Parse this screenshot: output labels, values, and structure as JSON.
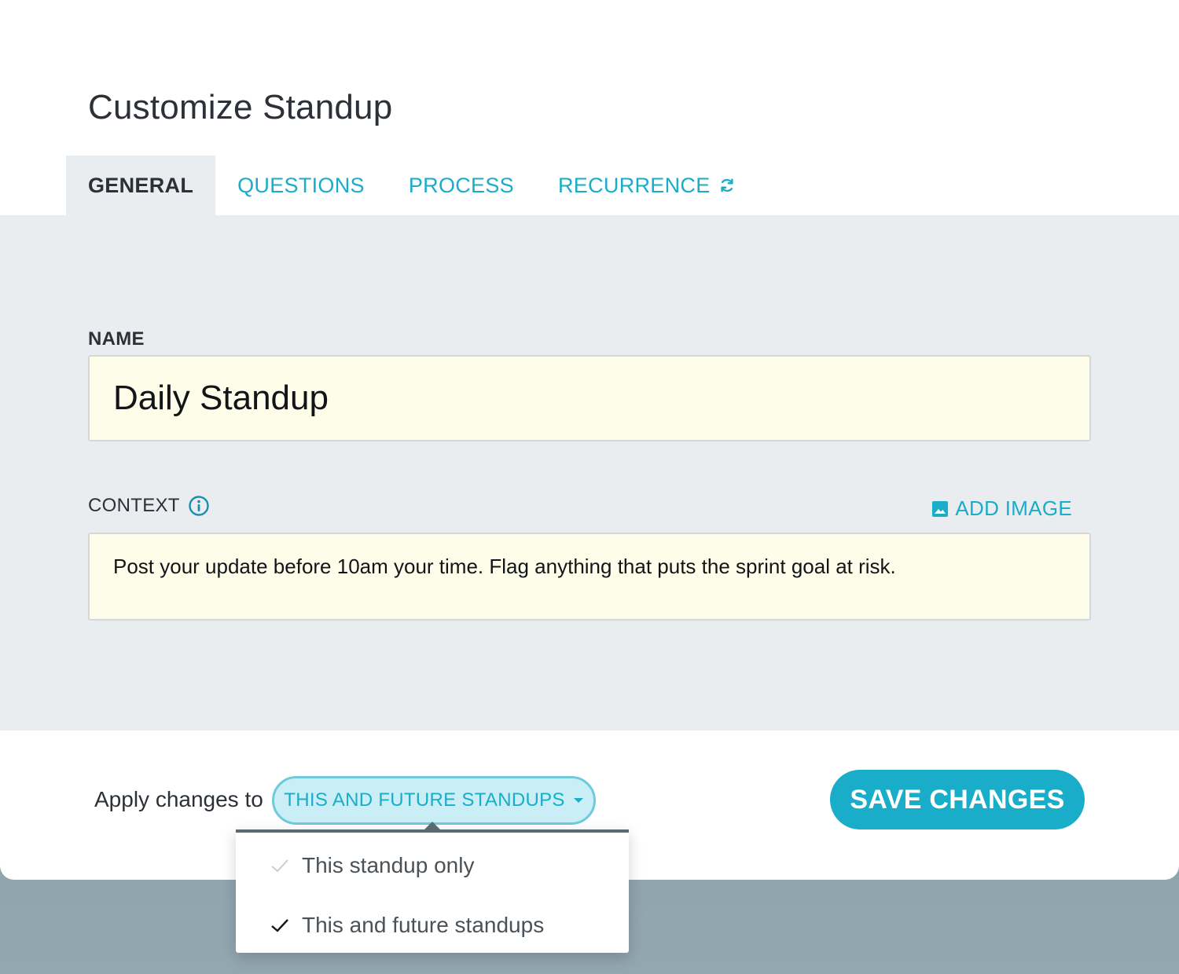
{
  "dialog": {
    "title": "Customize Standup",
    "tabs": [
      {
        "label": "GENERAL",
        "active": true
      },
      {
        "label": "QUESTIONS",
        "active": false
      },
      {
        "label": "PROCESS",
        "active": false
      },
      {
        "label": "RECURRENCE",
        "active": false,
        "icon": "refresh-icon"
      }
    ]
  },
  "form": {
    "name_label": "NAME",
    "name_value": "Daily Standup",
    "context_label": "CONTEXT",
    "context_info_icon": "info-icon",
    "add_image_label": "ADD IMAGE",
    "add_image_icon": "image-icon",
    "context_value": "Post your update before 10am your time. Flag anything that puts the sprint goal at risk."
  },
  "footer": {
    "apply_label": "Apply changes to",
    "scope_value": "THIS AND FUTURE STANDUPS",
    "save_label": "SAVE CHANGES"
  },
  "dropdown": {
    "options": [
      {
        "label": "This standup only",
        "selected": false
      },
      {
        "label": "This and future standups",
        "selected": true
      }
    ]
  },
  "colors": {
    "accent": "#19adc9",
    "panel": "#e9edf0",
    "field": "#fefde9",
    "text": "#2b3137"
  }
}
